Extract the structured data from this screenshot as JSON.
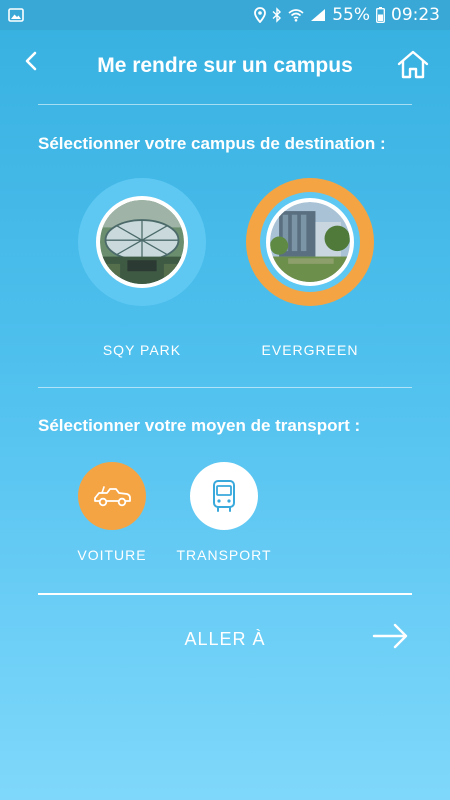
{
  "status_bar": {
    "battery": "55%",
    "time": "09:23",
    "left_icons": [
      "image-icon"
    ],
    "right_icons": [
      "location-icon",
      "bluetooth-icon",
      "wifi-icon",
      "signal-icon",
      "battery-icon"
    ]
  },
  "header": {
    "title": "Me rendre sur un campus",
    "back_icon": "chevron-left-icon",
    "home_icon": "home-icon"
  },
  "campus_section": {
    "heading": "Sélectionner votre campus de destination :",
    "campuses": [
      {
        "label": "SQY PARK",
        "selected": false
      },
      {
        "label": "EVERGREEN",
        "selected": true
      }
    ]
  },
  "transport_section": {
    "heading": "Sélectionner votre moyen de transport :",
    "options": [
      {
        "label": "VOITURE",
        "icon": "car-icon",
        "selected": true
      },
      {
        "label": "TRANSPORT",
        "icon": "bus-icon",
        "selected": false
      }
    ]
  },
  "action": {
    "label": "ALLER À",
    "icon": "arrow-right-icon"
  },
  "colors": {
    "accent_orange": "#f5a443",
    "ring_blue": "#5ec8f2",
    "background_top": "#36b0e0",
    "background_bottom": "#7fd8fb"
  }
}
